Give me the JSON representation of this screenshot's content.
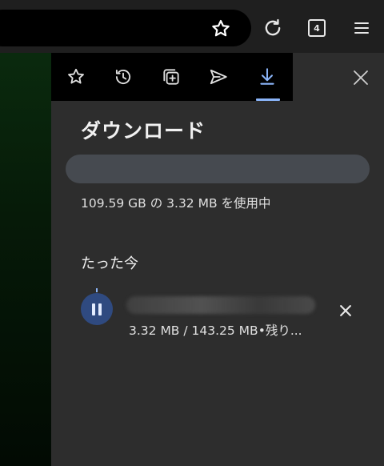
{
  "toolbar": {
    "bookmark_icon": "star-outline-icon",
    "reload_icon": "reload-icon",
    "tab_count": "4",
    "menu_icon": "hamburger-menu-icon"
  },
  "panel": {
    "tabs": [
      {
        "icon": "bookmarks-star-icon",
        "selected": false
      },
      {
        "icon": "history-icon",
        "selected": false
      },
      {
        "icon": "tab-collections-icon",
        "selected": false
      },
      {
        "icon": "send-share-icon",
        "selected": false
      },
      {
        "icon": "download-icon",
        "selected": true
      }
    ],
    "close_icon": "close-icon",
    "title": "ダウンロード",
    "storage_text": "109.59 GB の 3.32 MB を使用中",
    "section_label": "たった今",
    "downloads": [
      {
        "file_name": "",
        "status": "3.32 MB / 143.25 MB•残り...",
        "progress": 0.023,
        "state": "downloading"
      }
    ]
  },
  "colors": {
    "accent": "#8ab4f8",
    "panel_bg": "#2d2d2d",
    "pause_button": "#2f4a80",
    "storage_bar": "#464a50"
  }
}
